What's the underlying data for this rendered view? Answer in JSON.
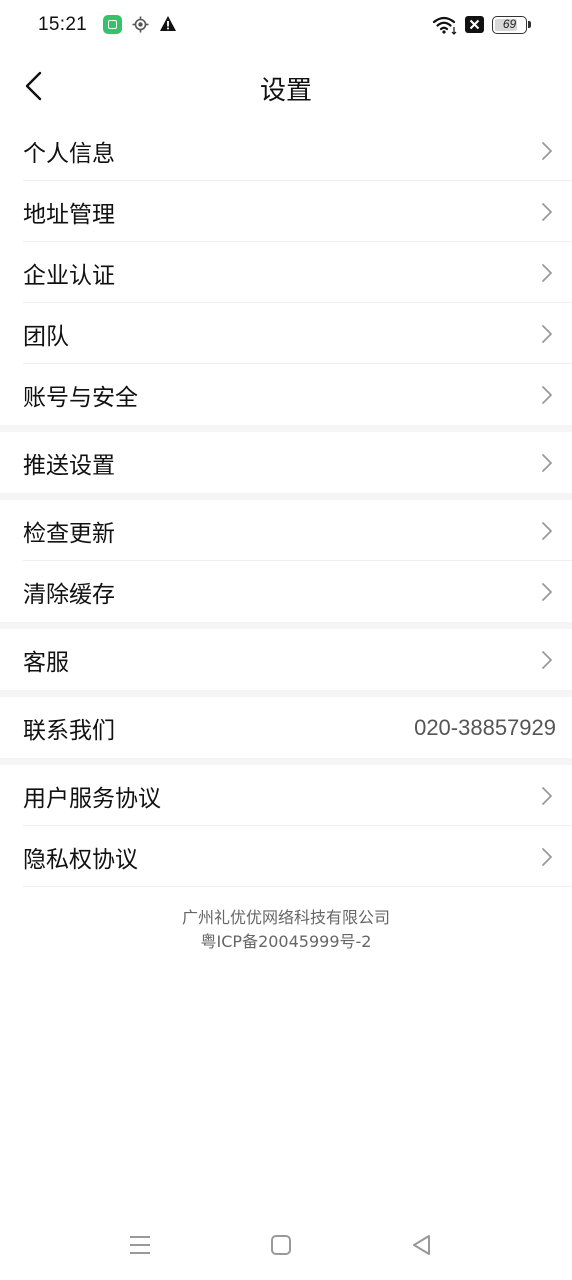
{
  "status_bar": {
    "time": "15:21",
    "battery_level": "69",
    "icons": [
      "app-notification-icon",
      "location-icon",
      "warning-icon",
      "wifi-icon",
      "close-box-icon",
      "battery-icon"
    ]
  },
  "header": {
    "title": "设置",
    "back_icon": "chevron-left-icon"
  },
  "groups": [
    {
      "items": [
        {
          "label": "个人信息"
        },
        {
          "label": "地址管理"
        },
        {
          "label": "企业认证"
        },
        {
          "label": "团队"
        },
        {
          "label": "账号与安全"
        }
      ]
    },
    {
      "items": [
        {
          "label": "推送设置"
        }
      ]
    },
    {
      "items": [
        {
          "label": "检查更新"
        },
        {
          "label": "清除缓存"
        }
      ]
    },
    {
      "items": [
        {
          "label": "客服"
        }
      ]
    },
    {
      "items": [
        {
          "label": "联系我们",
          "value": "020-38857929"
        }
      ]
    },
    {
      "items": [
        {
          "label": "用户服务协议"
        },
        {
          "label": "隐私权协议"
        }
      ]
    }
  ],
  "footer": {
    "company": "广州礼优优网络科技有限公司",
    "icp": "粤ICP备20045999号-2"
  },
  "colors": {
    "separator": "#f5f5f5",
    "divider": "#eeeeee",
    "app_icon": "#34c26b"
  }
}
